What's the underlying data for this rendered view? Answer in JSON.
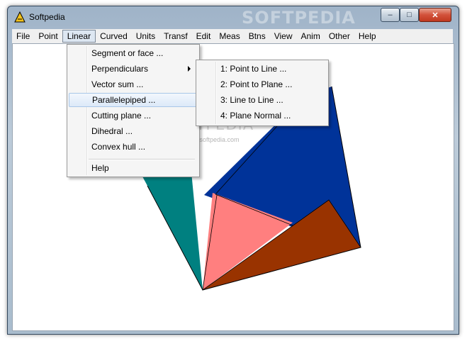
{
  "window": {
    "title": "Softpedia",
    "watermark": "SOFTPEDIA",
    "minimize_glyph": "–",
    "maximize_glyph": "□",
    "close_glyph": "✕"
  },
  "menubar": {
    "items": [
      "File",
      "Point",
      "Linear",
      "Curved",
      "Units",
      "Transf",
      "Edit",
      "Meas",
      "Btns",
      "View",
      "Anim",
      "Other",
      "Help"
    ],
    "active": "Linear"
  },
  "linear_menu": {
    "items": [
      "Segment or face ...",
      "Perpendiculars",
      "Vector sum ...",
      "Parallelepiped ...",
      "Cutting plane ...",
      "Dihedral ...",
      "Convex hull ...",
      "Help"
    ],
    "highlighted": "Parallelepiped ...",
    "submenu_parent": "Perpendiculars"
  },
  "perpendiculars_submenu": {
    "items": [
      "1: Point to Line ...",
      "2: Point to Plane ...",
      "3: Line to Line ...",
      "4: Plane Normal ..."
    ]
  },
  "canvas": {
    "watermark_text": "SOFTPEDIA",
    "watermark_url": "www.softpedia.com",
    "faces": [
      {
        "name": "teal-face",
        "color": "#008080"
      },
      {
        "name": "blue-face",
        "color": "#003399"
      },
      {
        "name": "pink-face",
        "color": "#ff7f7f"
      },
      {
        "name": "brown-face",
        "color": "#993300"
      }
    ]
  }
}
